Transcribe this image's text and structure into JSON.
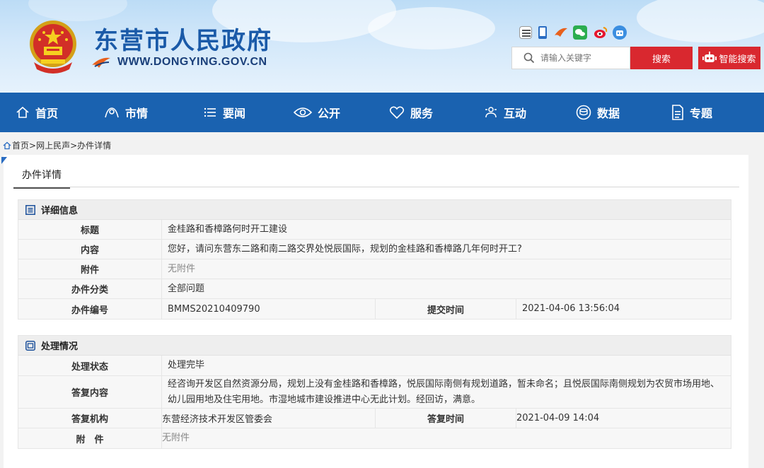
{
  "header": {
    "site_title": "东营市人民政府",
    "site_url": "WWW.DONGYING.GOV.CN",
    "search_placeholder": "请输入关键字",
    "search_button": "搜索",
    "smart_search_button": "智能搜索",
    "social_icons": [
      "gov-service-icon",
      "mobile-icon",
      "app-icon",
      "wechat-icon",
      "weibo-icon",
      "robot-icon"
    ]
  },
  "nav": {
    "items": [
      {
        "label": "首页",
        "icon": "home-icon"
      },
      {
        "label": "市情",
        "icon": "city-icon"
      },
      {
        "label": "要闻",
        "icon": "list-icon"
      },
      {
        "label": "公开",
        "icon": "eye-icon"
      },
      {
        "label": "服务",
        "icon": "heart-icon"
      },
      {
        "label": "互动",
        "icon": "interact-icon"
      },
      {
        "label": "数据",
        "icon": "data-icon"
      },
      {
        "label": "专题",
        "icon": "document-icon"
      }
    ]
  },
  "breadcrumb": {
    "home": "首页",
    "sep": ">",
    "level2": "网上民声",
    "level3": "办件详情"
  },
  "panel": {
    "tab_label": "办件详情"
  },
  "detail": {
    "heading": "详细信息",
    "title_label": "标题",
    "title_value": "金桂路和香樟路何时开工建设",
    "content_label": "内容",
    "content_value": "您好，请问东营东二路和南二路交界处悦辰国际，规划的金桂路和香樟路几年何时开工?",
    "attachment_label": "附件",
    "attachment_value": "无附件",
    "category_label": "办件分类",
    "category_value": "全部问题",
    "number_label": "办件编号",
    "number_value": "BMMS20210409790",
    "submit_time_label": "提交时间",
    "submit_time_value": "2021-04-06 13:56:04"
  },
  "handling": {
    "heading": "处理情况",
    "status_label": "处理状态",
    "status_value": "处理完毕",
    "reply_label": "答复内容",
    "reply_value": "经咨询开发区自然资源分局，规划上没有金桂路和香樟路，悦辰国际南侧有规划道路，暂未命名；且悦辰国际南侧规划为农贸市场用地、幼儿园用地及住宅用地。市湿地城市建设推进中心无此计划。经回访，满意。",
    "org_label": "答复机构",
    "org_value": "东营经济技术开发区管委会",
    "reply_time_label": "答复时间",
    "reply_time_value": "2021-04-09 14:04",
    "attachment_label": "附　件",
    "attachment_value": "无附件"
  },
  "colors": {
    "nav_bg": "#1a62b0",
    "title_blue": "#1a5aa8",
    "button_red": "#d9282f"
  }
}
